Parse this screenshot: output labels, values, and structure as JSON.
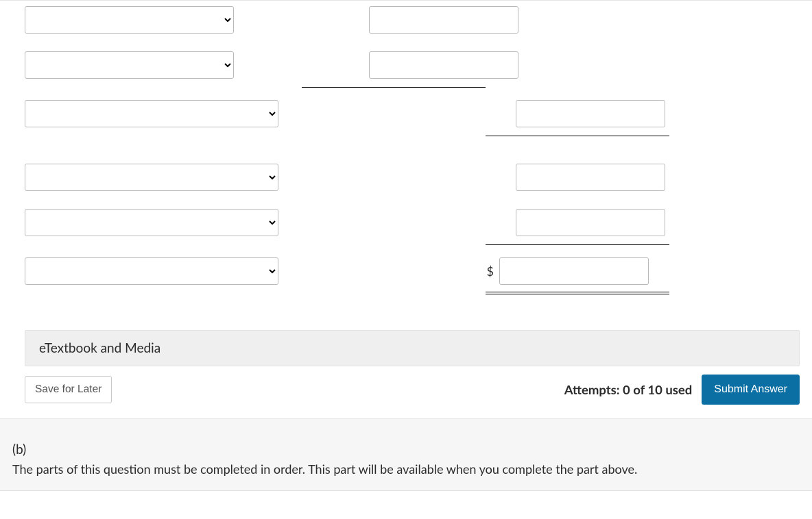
{
  "etextbook_label": "eTextbook and Media",
  "save_label": "Save for Later",
  "attempts_text": "Attempts: 0 of 10 used",
  "submit_label": "Submit Answer",
  "currency_symbol": "$",
  "part_b": {
    "label": "(b)",
    "message": "The parts of this question must be completed in order. This part will be available when you complete the part above."
  }
}
